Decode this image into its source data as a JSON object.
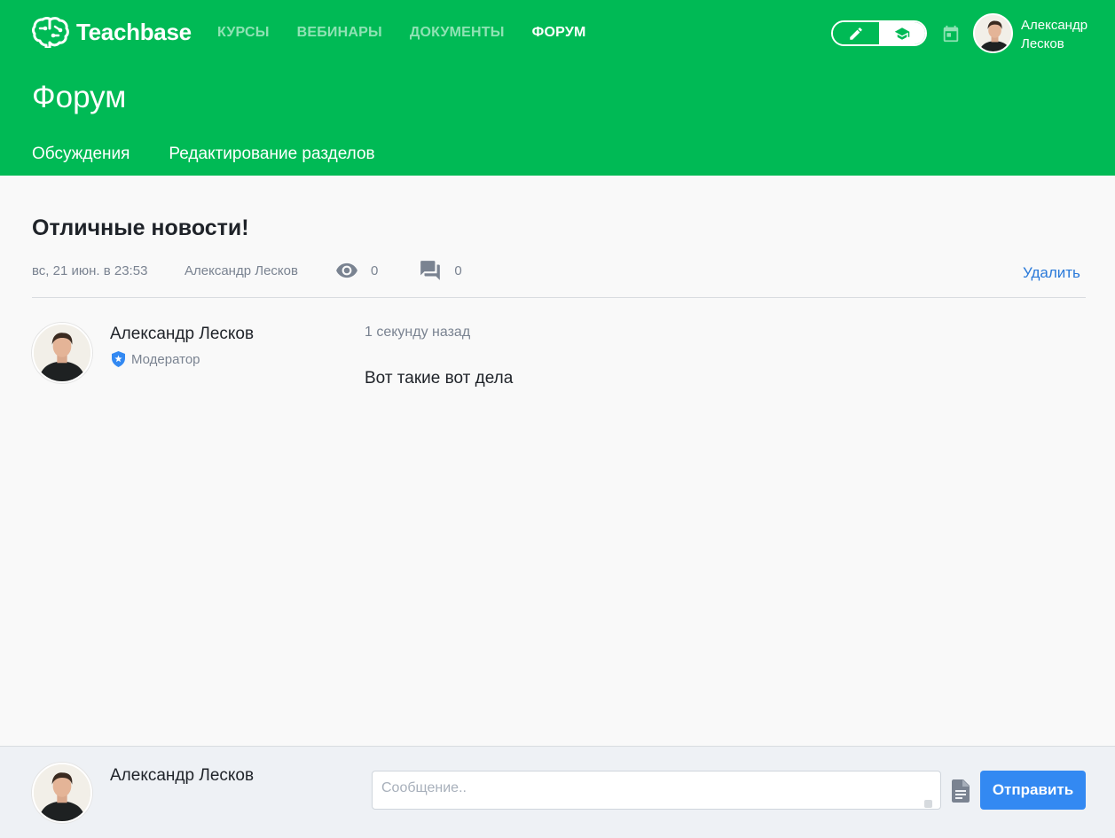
{
  "app": {
    "brand": "Teachbase",
    "nav": [
      {
        "label": "КУРСЫ",
        "active": false
      },
      {
        "label": "ВЕБИНАРЫ",
        "active": false
      },
      {
        "label": "ДОКУМЕНТЫ",
        "active": false
      },
      {
        "label": "ФОРУМ",
        "active": true
      }
    ],
    "mode_toggle": {
      "left_icon": "pencil-icon",
      "right_icon": "graduation-cap-icon",
      "active": "right"
    },
    "calendar_icon": "calendar-icon",
    "user": {
      "first_name": "Александр",
      "last_name": "Лесков"
    }
  },
  "page": {
    "title": "Форум",
    "subnav": [
      "Обсуждения",
      "Редактирование разделов"
    ]
  },
  "topic": {
    "title": "Отличные новости!",
    "date": "вс, 21 июн. в 23:53",
    "author": "Александр Лесков",
    "views": "0",
    "replies": "0",
    "delete_label": "Удалить"
  },
  "post": {
    "author": "Александр Лесков",
    "role": "Модератор",
    "time": "1 секунду назад",
    "text": "Вот такие вот дела"
  },
  "composer": {
    "author": "Александр Лесков",
    "placeholder": "Сообщение..",
    "value": "",
    "send_label": "Отправить"
  },
  "colors": {
    "brand_green": "#00ba55",
    "link_blue": "#2979d9",
    "button_blue": "#3389f2",
    "muted": "#7a8391"
  }
}
